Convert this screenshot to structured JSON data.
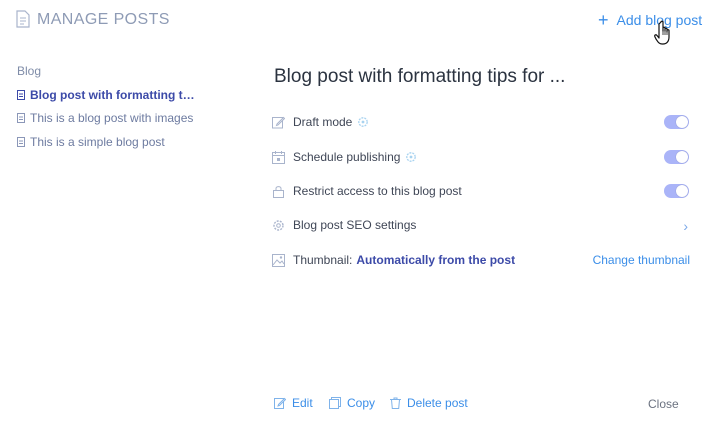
{
  "header": {
    "title": "MANAGE POSTS",
    "add_label": "Add blog post",
    "add_icon": "plus-icon"
  },
  "sidebar": {
    "title": "Blog",
    "items": [
      {
        "label": "Blog post with formatting tips for ...",
        "active": true
      },
      {
        "label": "This is a blog post with images",
        "active": false
      },
      {
        "label": "This is a simple blog post",
        "active": false
      }
    ]
  },
  "main": {
    "title": "Blog post with formatting tips for ...",
    "rows": {
      "draft": {
        "label": "Draft mode",
        "icon": "pencil-icon",
        "toggle_on": true
      },
      "schedule": {
        "label": "Schedule publishing",
        "icon": "calendar-icon",
        "toggle_on": true
      },
      "restrict": {
        "label": "Restrict access to this blog post",
        "icon": "lock-icon",
        "toggle_on": true
      },
      "seo": {
        "label": "Blog post SEO settings",
        "icon": "gear-icon"
      },
      "thumbnail": {
        "label": "Thumbnail:",
        "value": "Automatically from the post",
        "action": "Change thumbnail",
        "icon": "image-icon"
      }
    }
  },
  "footer": {
    "edit": "Edit",
    "copy": "Copy",
    "delete": "Delete post",
    "close": "Close"
  },
  "colors": {
    "accent": "#3b8ee8",
    "active_text": "#3c4aa8",
    "toggle": "#aab4f8"
  }
}
